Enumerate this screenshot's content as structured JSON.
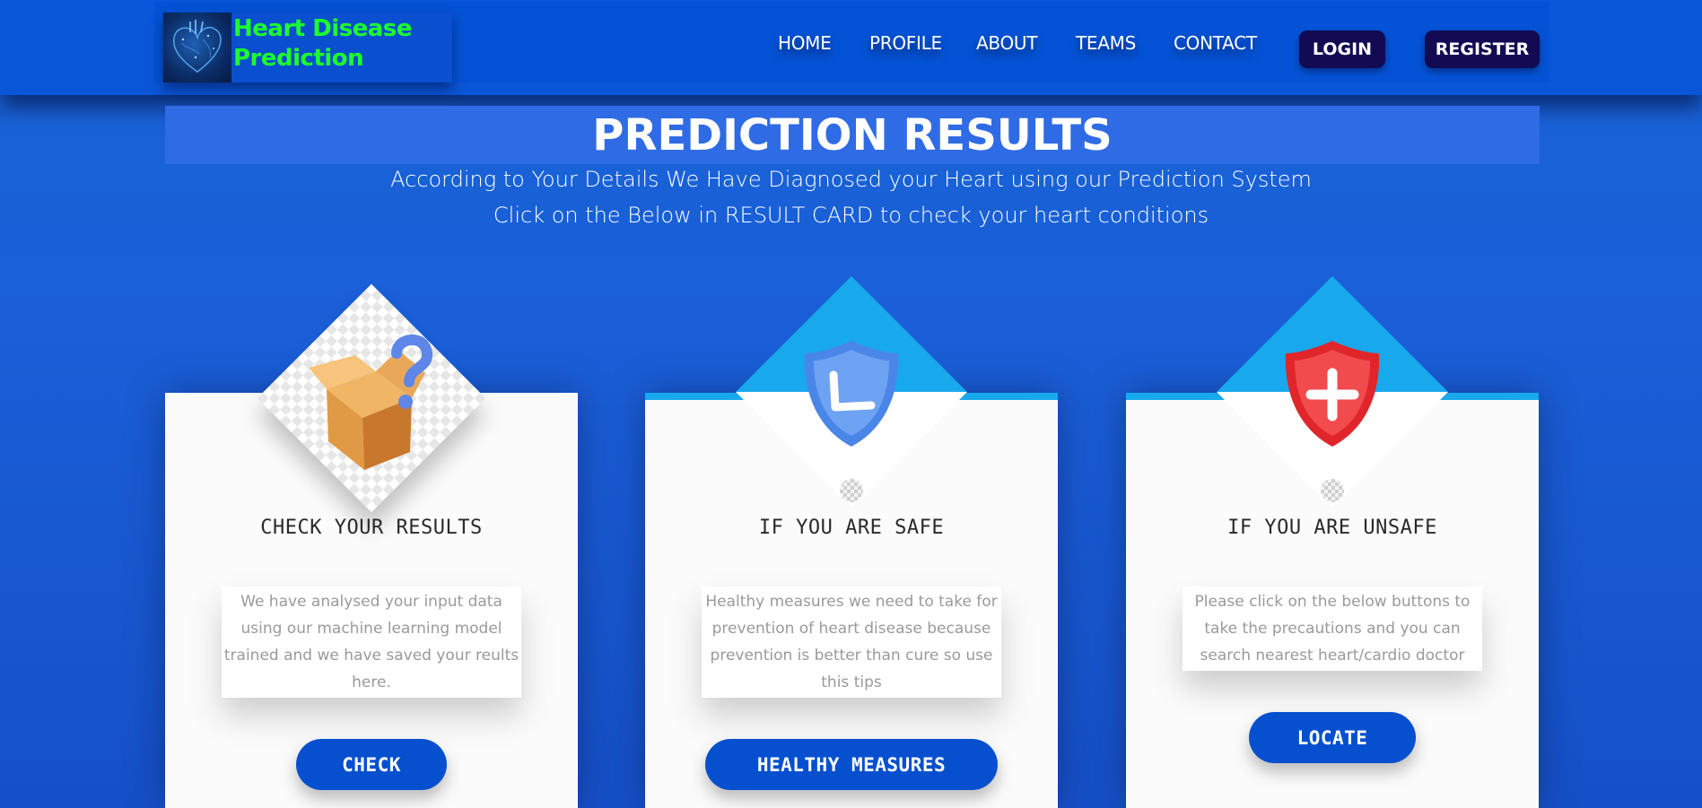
{
  "brand": {
    "title_line1": "Heart Disease",
    "title_line2": "Prediction",
    "logo_icon": "heart-anatomy-icon",
    "title_color": "#1dff2c"
  },
  "nav": {
    "items": [
      {
        "label": "HOME"
      },
      {
        "label": "PROFILE"
      },
      {
        "label": "ABOUT"
      },
      {
        "label": "TEAMS"
      },
      {
        "label": "CONTACT"
      }
    ],
    "login_label": "LOGIN",
    "register_label": "REGISTER"
  },
  "page": {
    "title": "PREDICTION RESULTS",
    "subtitle_line1": "According to Your Details We Have Diagnosed your Heart using our Prediction System",
    "subtitle_line2": "Click on the Below in RESULT CARD to check your heart conditions"
  },
  "cards": [
    {
      "icon": "open-box-question-icon",
      "title": "CHECK YOUR RESULTS",
      "text": "We have analysed your input data using our machine learning model trained and we have saved your reults here.",
      "button": "CHECK"
    },
    {
      "icon": "shield-check-icon",
      "title": "IF YOU ARE SAFE",
      "text": "Healthy measures we need to take for prevention of heart disease because prevention is better than cure so use this tips",
      "button": "HEALTHY MEASURES"
    },
    {
      "icon": "shield-plus-icon",
      "title": "IF YOU ARE UNSAFE",
      "text": "Please click on the below buttons to take the precautions and you can search nearest heart/cardio doctor",
      "button": "LOCATE"
    }
  ],
  "colors": {
    "background": "#1a5fd8",
    "nav_button": "#120a52",
    "card_button": "#0650cf",
    "accent": "#18a8ec"
  }
}
